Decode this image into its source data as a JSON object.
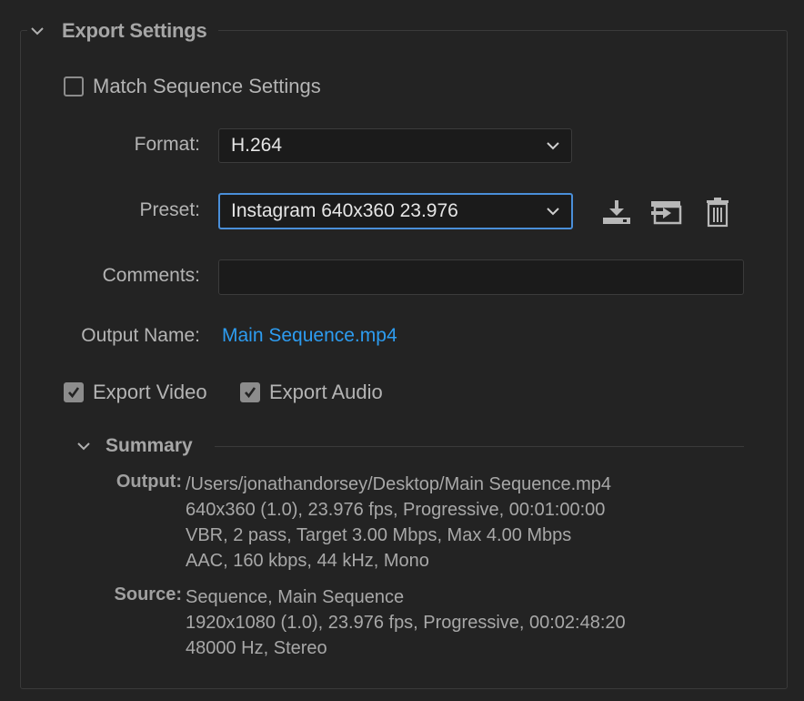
{
  "export_settings": {
    "title": "Export Settings",
    "match_sequence": {
      "label": "Match Sequence Settings",
      "checked": false
    },
    "format": {
      "label": "Format:",
      "value": "H.264"
    },
    "preset": {
      "label": "Preset:",
      "value": "Instagram 640x360 23.976"
    },
    "preset_icons": [
      "save-preset-icon",
      "import-preset-icon",
      "trash-icon"
    ],
    "comments": {
      "label": "Comments:",
      "value": ""
    },
    "output_name": {
      "label": "Output Name:",
      "value": "Main Sequence.mp4"
    },
    "export_video": {
      "label": "Export Video",
      "checked": true
    },
    "export_audio": {
      "label": "Export Audio",
      "checked": true
    }
  },
  "summary": {
    "title": "Summary",
    "output_label": "Output:",
    "output_lines": [
      "/Users/jonathandorsey/Desktop/Main Sequence.mp4",
      "640x360 (1.0), 23.976 fps, Progressive, 00:01:00:00",
      "VBR, 2 pass, Target 3.00 Mbps, Max 4.00 Mbps",
      "AAC, 160 kbps, 44 kHz, Mono"
    ],
    "source_label": "Source:",
    "source_lines": [
      "Sequence, Main Sequence",
      "1920x1080 (1.0), 23.976 fps, Progressive, 00:02:48:20",
      "48000 Hz, Stereo"
    ]
  },
  "colors": {
    "background": "#232323",
    "link": "#2d9cf0",
    "focus": "#4a8fd9",
    "field_bg": "#1b1b1b"
  }
}
